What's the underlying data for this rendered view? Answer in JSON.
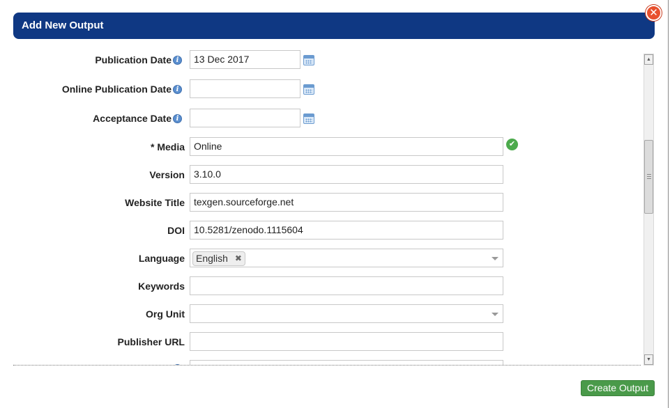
{
  "dialog": {
    "title": "Add New Output",
    "close_icon": "close-icon",
    "submit_label": "Create Output"
  },
  "form": {
    "publication_date": {
      "label": "Publication Date",
      "value": "13 Dec 2017"
    },
    "online_publication_date": {
      "label": "Online Publication Date",
      "value": ""
    },
    "acceptance_date": {
      "label": "Acceptance Date",
      "value": ""
    },
    "media": {
      "label": "* Media",
      "value": "Online",
      "status_icon": "check-icon"
    },
    "version": {
      "label": "Version",
      "value": "3.10.0"
    },
    "website_title": {
      "label": "Website Title",
      "value": "texgen.sourceforge.net"
    },
    "doi": {
      "label": "DOI",
      "value": "10.5281/zenodo.1115604"
    },
    "language": {
      "label": "Language",
      "selected": "English",
      "remove_icon": "✖"
    },
    "keywords": {
      "label": "Keywords",
      "value": ""
    },
    "org_unit": {
      "label": "Org Unit",
      "value": ""
    },
    "publisher_url": {
      "label": "Publisher URL",
      "value": ""
    }
  },
  "colors": {
    "header_bg": "#0f3883",
    "submit_bg": "#4a9a4a",
    "close_bg": "#e8502e"
  }
}
